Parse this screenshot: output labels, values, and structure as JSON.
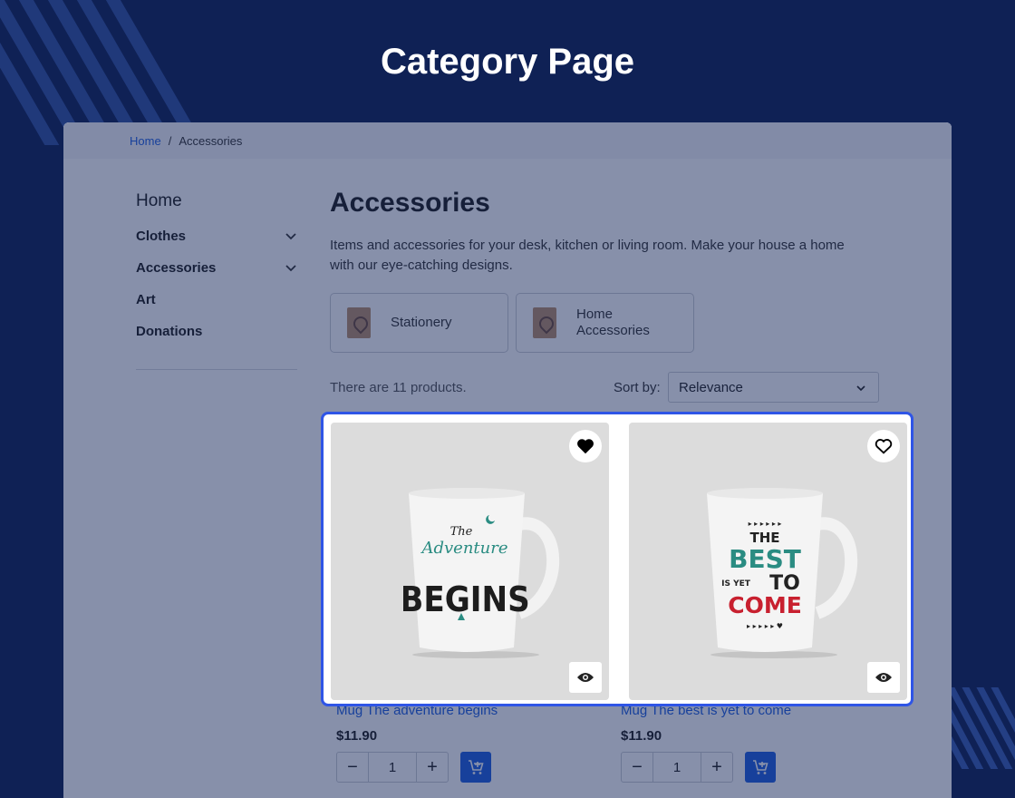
{
  "page_heading": "Category Page",
  "breadcrumb": {
    "home": "Home",
    "separator": "/",
    "current": "Accessories"
  },
  "sidebar": {
    "title": "Home",
    "items": [
      {
        "label": "Clothes",
        "expandable": true
      },
      {
        "label": "Accessories",
        "expandable": true
      },
      {
        "label": "Art",
        "expandable": false
      },
      {
        "label": "Donations",
        "expandable": false
      }
    ]
  },
  "category": {
    "title": "Accessories",
    "description": "Items and accessories for your desk, kitchen or living room. Make your house a home with our eye-catching designs.",
    "subcategories": [
      {
        "label": "Stationery"
      },
      {
        "label": "Home Accessories"
      }
    ]
  },
  "listing": {
    "count_text": "There are 11 products.",
    "sort_label": "Sort by:",
    "sort_value": "Relevance"
  },
  "products": [
    {
      "name": "Mug The adventure begins",
      "price": "$11.90",
      "quantity": "1",
      "favorited": true,
      "mug_text": {
        "line1": "The",
        "line2": "Adventure",
        "line3": "BEGINS"
      }
    },
    {
      "name": "Mug The best is yet to come",
      "price": "$11.90",
      "quantity": "1",
      "favorited": false,
      "mug_text": {
        "line1": "THE",
        "line2": "BEST",
        "line3": "IS YET",
        "line4": "TO",
        "line5": "COME"
      }
    }
  ],
  "controls": {
    "minus": "−",
    "plus": "+"
  },
  "colors": {
    "background": "#0f2155",
    "accent": "#1f5fe0",
    "highlight": "#2f55e6",
    "teal": "#2a8c82",
    "red": "#c8202f"
  }
}
